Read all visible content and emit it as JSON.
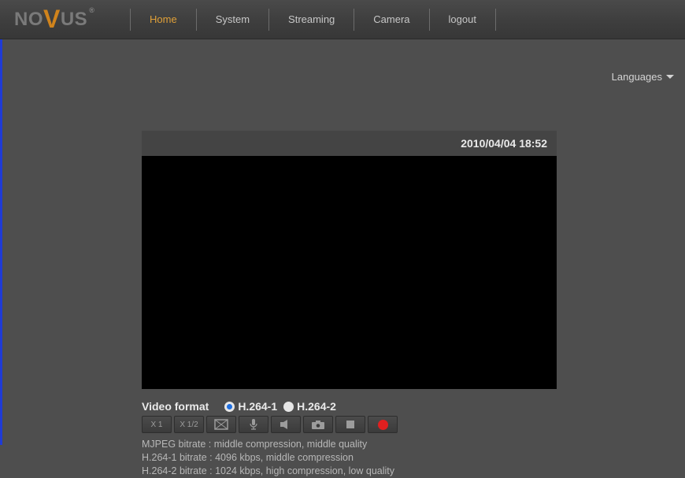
{
  "brand": {
    "pre": "NO",
    "v": "V",
    "post": "US"
  },
  "nav": {
    "items": [
      {
        "label": "Home",
        "active": true
      },
      {
        "label": "System",
        "active": false
      },
      {
        "label": "Streaming",
        "active": false
      },
      {
        "label": "Camera",
        "active": false
      },
      {
        "label": "logout",
        "active": false
      }
    ]
  },
  "languages_label": "Languages",
  "video": {
    "timestamp": "2010/04/04 18:52"
  },
  "format": {
    "label": "Video format",
    "options": [
      {
        "label": "H.264-1",
        "selected": true
      },
      {
        "label": "H.264-2",
        "selected": false
      }
    ]
  },
  "toolbar": {
    "zoom1": "X 1",
    "zoomhalf": "X 1/2"
  },
  "info": {
    "line1": "MJPEG bitrate : middle compression, middle quality",
    "line2": "H.264-1 bitrate : 4096 kbps, middle compression",
    "line3": "H.264-2 bitrate : 1024 kbps, high compression, low quality"
  }
}
